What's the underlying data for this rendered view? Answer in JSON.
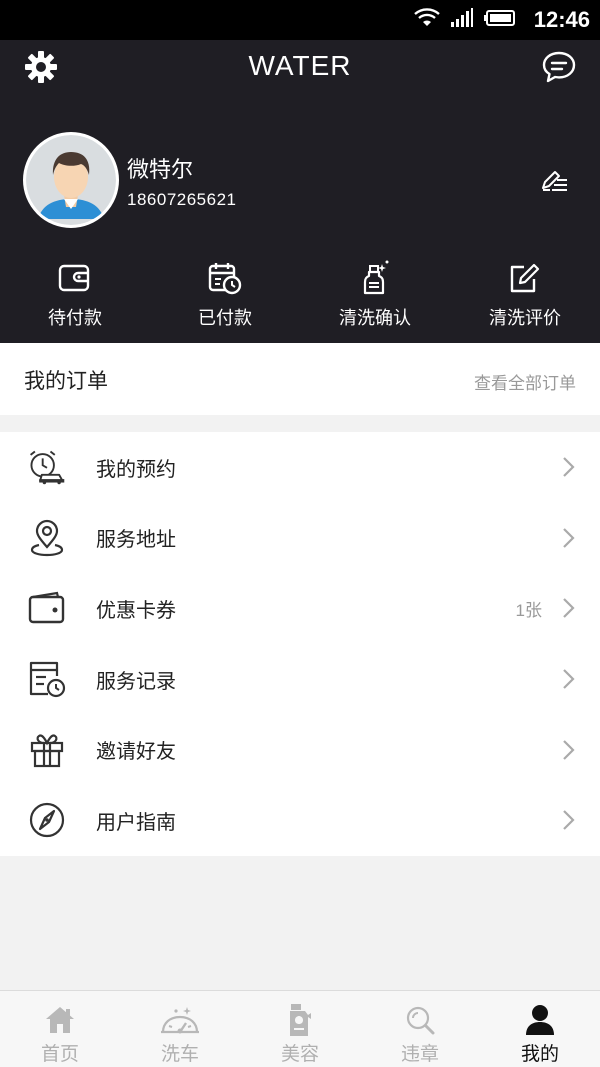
{
  "status_bar": {
    "time": "12:46"
  },
  "header": {
    "title": "WATER"
  },
  "profile": {
    "name": "微特尔",
    "phone": "18607265621"
  },
  "order_statuses": [
    {
      "label": "待付款",
      "icon": "wallet-icon"
    },
    {
      "label": "已付款",
      "icon": "calendar-clock-icon"
    },
    {
      "label": "清洗确认",
      "icon": "spray-bottle-icon"
    },
    {
      "label": "清洗评价",
      "icon": "edit-review-icon"
    }
  ],
  "orders": {
    "title": "我的订单",
    "view_all": "查看全部订单"
  },
  "menu": [
    {
      "label": "我的预约",
      "icon": "alarm-car-icon",
      "badge": ""
    },
    {
      "label": "服务地址",
      "icon": "location-pin-icon",
      "badge": ""
    },
    {
      "label": "优惠卡券",
      "icon": "coupon-wallet-icon",
      "badge": "1张"
    },
    {
      "label": "服务记录",
      "icon": "record-clock-icon",
      "badge": ""
    },
    {
      "label": "邀请好友",
      "icon": "gift-icon",
      "badge": ""
    },
    {
      "label": "用户指南",
      "icon": "compass-icon",
      "badge": ""
    }
  ],
  "tabs": [
    {
      "label": "首页",
      "icon": "home-icon",
      "active": false
    },
    {
      "label": "洗车",
      "icon": "car-wash-icon",
      "active": false
    },
    {
      "label": "美容",
      "icon": "bottle-icon",
      "active": false
    },
    {
      "label": "违章",
      "icon": "search-icon",
      "active": false
    },
    {
      "label": "我的",
      "icon": "user-icon",
      "active": true
    }
  ],
  "colors": {
    "header_bg": "#1f1e24",
    "active_tab": "#111111",
    "inactive_tab": "#b0b0b0"
  }
}
